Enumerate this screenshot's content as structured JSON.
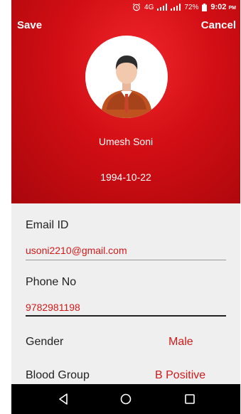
{
  "status": {
    "network": "4G",
    "battery": "72%",
    "time": "9:02",
    "ampm": "PM"
  },
  "toolbar": {
    "save_label": "Save",
    "cancel_label": "Cancel"
  },
  "profile": {
    "name": "Umesh Soni",
    "dob": "1994-10-22"
  },
  "form": {
    "email_label": "Email ID",
    "email_value": "usoni2210@gmail.com",
    "phone_label": "Phone No",
    "phone_value": "9782981198",
    "gender_label": "Gender",
    "gender_value": "Male",
    "blood_label": "Blood Group",
    "blood_value": "B Positive"
  },
  "colors": {
    "header": "#d10e14",
    "accent": "#d11a1a",
    "navbar": "#000000"
  },
  "icons": [
    "alarm-icon",
    "signal-icon",
    "battery-icon",
    "person-avatar",
    "back-icon",
    "home-icon",
    "recents-icon"
  ]
}
